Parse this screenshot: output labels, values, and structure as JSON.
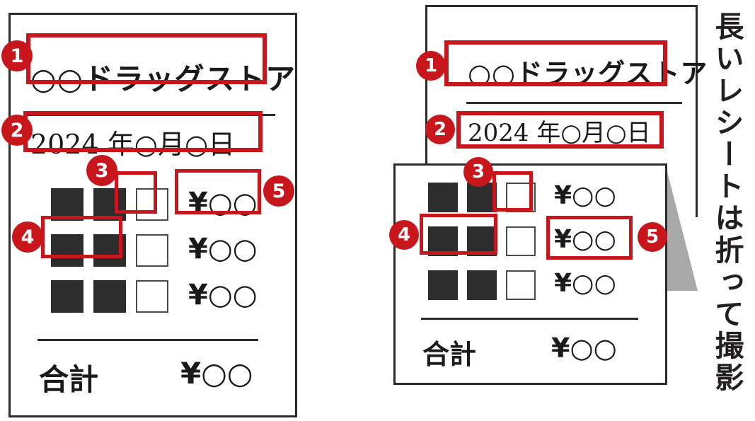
{
  "caption": {
    "vertical_text": "長いレシートは折って撮影"
  },
  "receipts": {
    "unfolded": {
      "store_name": "○○ドラッグストア",
      "date_line": "2024 年○月○日",
      "items": [
        {
          "price": "¥○○"
        },
        {
          "price": "¥○○"
        },
        {
          "price": "¥○○"
        }
      ],
      "total_label": "合計",
      "total_price": "¥○○"
    },
    "folded": {
      "store_name": "○○ドラッグストア",
      "date_line": "2024 年○月○日",
      "items": [
        {
          "price": "¥○○"
        },
        {
          "price": "¥○○"
        },
        {
          "price": "¥○○"
        }
      ],
      "total_label": "合計",
      "total_price": "¥○○"
    }
  },
  "badges": {
    "one": "1",
    "two": "2",
    "three": "3",
    "four": "4",
    "five": "5"
  },
  "colors": {
    "accent_red": "#c8161d",
    "ink": "#231f20",
    "block_fill": "#2d2d2d",
    "fold_shadow": "#a8a8a8"
  }
}
